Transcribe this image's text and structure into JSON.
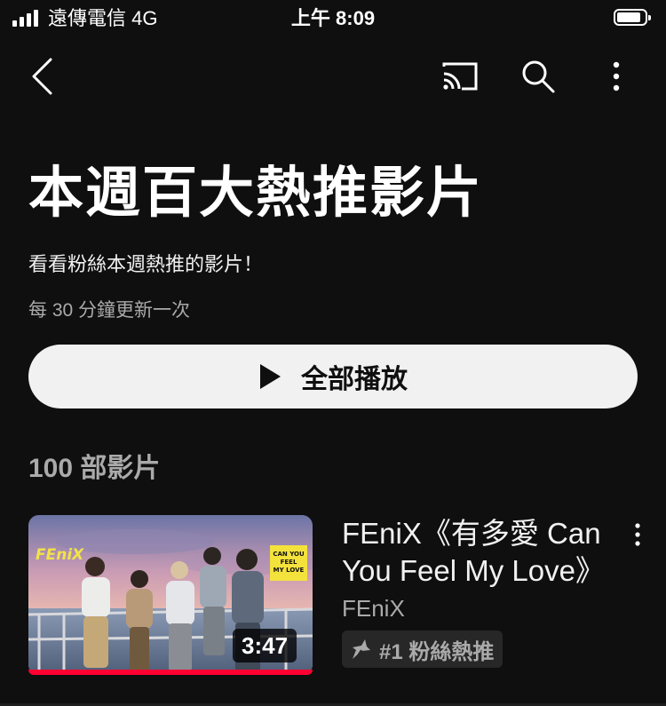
{
  "status_bar": {
    "carrier": "遠傳電信  4G",
    "time": "上午 8:09"
  },
  "app_bar": {
    "back_icon": "back-arrow-icon",
    "cast_icon": "cast-icon",
    "search_icon": "search-icon",
    "more_icon": "more-vertical-icon"
  },
  "header": {
    "title": "本週百大熱推影片",
    "subtitle": "看看粉絲本週熱推的影片！",
    "update_note": "每 30 分鐘更新一次",
    "play_all_label": "全部播放"
  },
  "list": {
    "count": "100 部影片",
    "items": [
      {
        "title": "FEniX《有多愛 Can You Feel My Love》",
        "channel": "FEniX",
        "duration": "3:47",
        "badge": "#1 粉絲熱推",
        "thumbnail_logo": "FEniX",
        "thumbnail_sign": "CAN YOU FEEL MY LOVE",
        "watch_progress": 1.0
      }
    ]
  },
  "colors": {
    "background": "#0f0f0f",
    "primary_text": "#f1f1f1",
    "secondary_text": "#aaaaaa",
    "play_button_bg": "#f1f1f1",
    "progress": "#ff0033",
    "badge_bg": "#272727"
  }
}
